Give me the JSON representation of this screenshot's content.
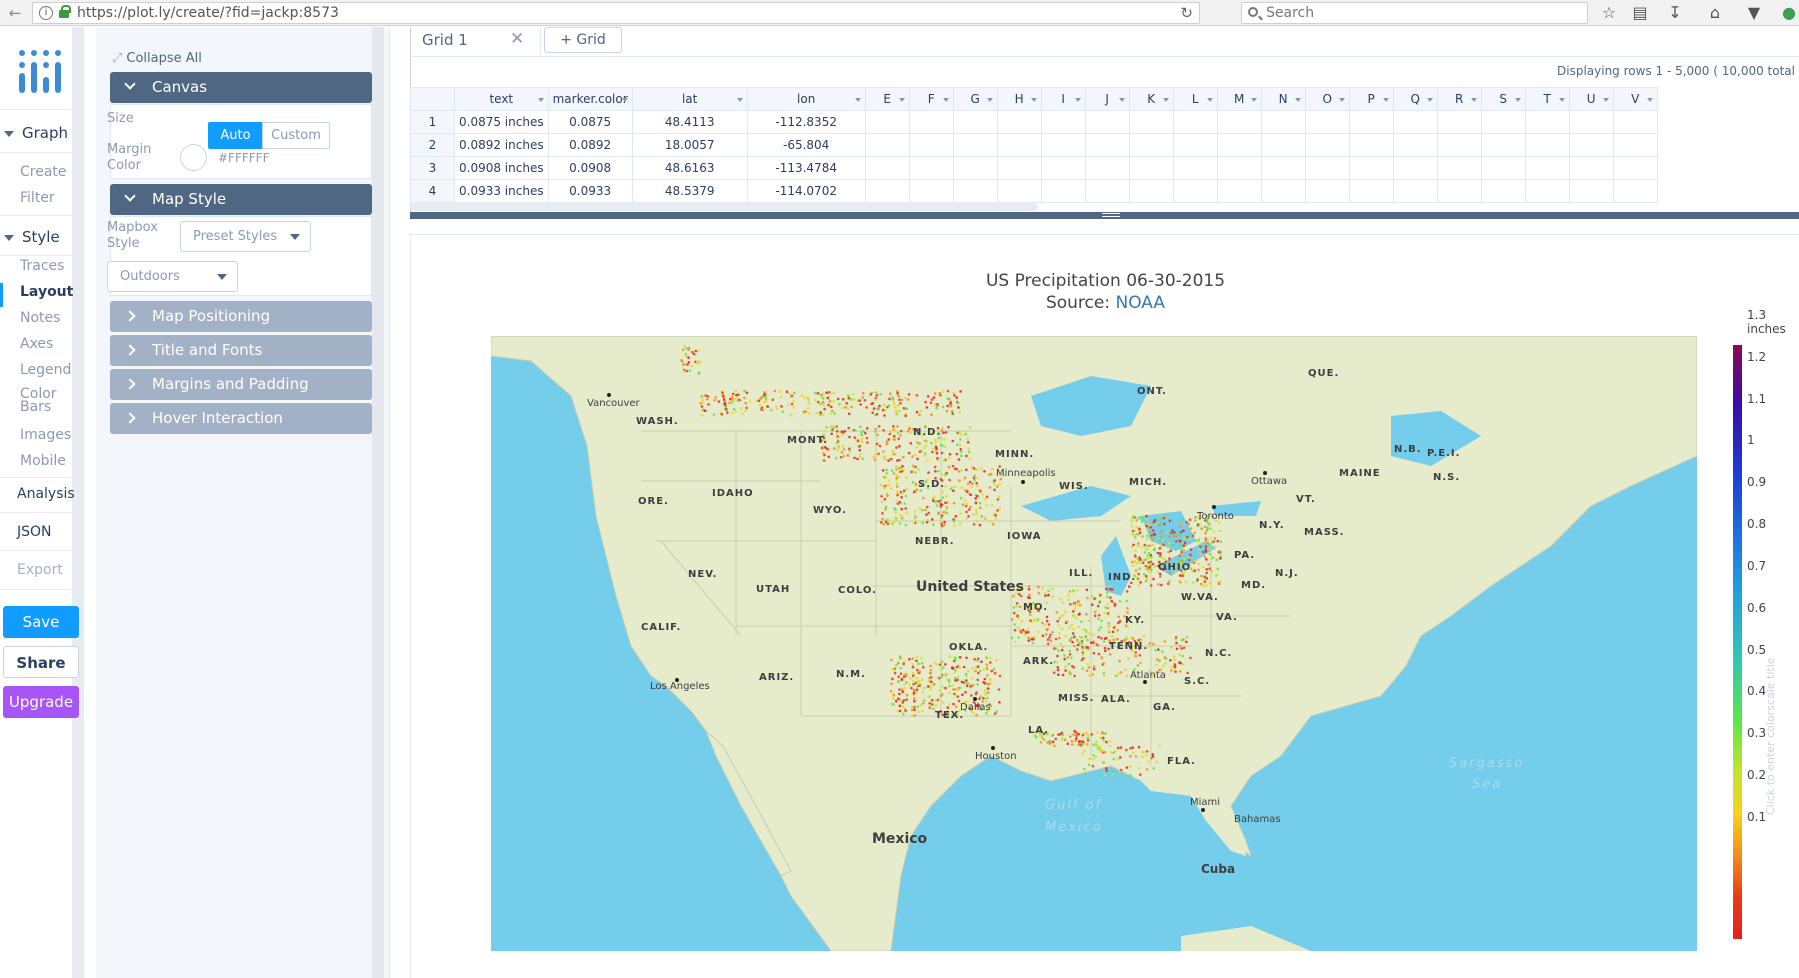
{
  "browser": {
    "url": "https://plot.ly/create/?fid=jackp:8573",
    "search_placeholder": "Search"
  },
  "nav": {
    "sections": [
      {
        "label": "Graph",
        "items": [
          "Create",
          "Filter"
        ]
      },
      {
        "label": "Style",
        "items": [
          "Traces",
          "Layout",
          "Notes",
          "Axes",
          "Legend",
          "Color Bars",
          "Images",
          "Mobile"
        ]
      }
    ],
    "active_item": "Layout",
    "analysis": "Analysis",
    "json": "JSON",
    "export": "Export",
    "save": "Save",
    "share": "Share",
    "upgrade": "Upgrade"
  },
  "panel": {
    "collapse_all": "Collapse All",
    "canvas": {
      "title": "Canvas",
      "size_label": "Size",
      "size_options": [
        "Auto",
        "Custom"
      ],
      "size_selected": "Auto",
      "margin_color_label": "Margin Color",
      "margin_color_value": "#FFFFFF"
    },
    "map_style": {
      "title": "Map Style",
      "mapbox_style_label": "Mapbox Style",
      "preset_placeholder": "Preset Styles",
      "style_value": "Outdoors"
    },
    "collapsed_sections": [
      "Map Positioning",
      "Title and Fonts",
      "Margins and Padding",
      "Hover Interaction"
    ]
  },
  "grid": {
    "tab_label": "Grid 1",
    "add_grid_label": "+ Grid",
    "rows_info": "Displaying rows 1 - 5,000 ( 10,000 total",
    "columns": [
      "text",
      "marker.color",
      "lat",
      "lon",
      "E",
      "F",
      "G",
      "H",
      "I",
      "J",
      "K",
      "L",
      "M",
      "N",
      "O",
      "P",
      "Q",
      "R",
      "S",
      "T",
      "U",
      "V"
    ],
    "rows": [
      {
        "n": "1",
        "text": "0.0875 inches",
        "color": "0.0875",
        "lat": "48.4113",
        "lon": "-112.8352"
      },
      {
        "n": "2",
        "text": "0.0892 inches",
        "color": "0.0892",
        "lat": "18.0057",
        "lon": "-65.804"
      },
      {
        "n": "3",
        "text": "0.0908 inches",
        "color": "0.0908",
        "lat": "48.6163",
        "lon": "-113.4784"
      },
      {
        "n": "4",
        "text": "0.0933 inches",
        "color": "0.0933",
        "lat": "48.5379",
        "lon": "-114.0702"
      }
    ]
  },
  "plot": {
    "title_line1": "US Precipitation 06-30-2015",
    "title_source_prefix": "Source: ",
    "title_source_link": "NOAA",
    "colorbar_ticks": [
      "1.3 inches",
      "1.2",
      "1.1",
      "1",
      "0.9",
      "0.8",
      "0.7",
      "0.6",
      "0.5",
      "0.4",
      "0.3",
      "0.2",
      "0.1"
    ],
    "colorbar_title_placeholder": "Click to enter colorscale title",
    "map_labels": {
      "country_us": "United States",
      "country_mx": "Mexico",
      "cuba": "Cuba",
      "bahamas": "Bahamas",
      "gulf1": "Gulf of",
      "gulf2": "Mexico",
      "sargasso1": "Sargasso",
      "sargasso2": "Sea",
      "states": [
        "WASH.",
        "ORE.",
        "CALIF.",
        "NEV.",
        "IDAHO",
        "MONT.",
        "WYO.",
        "UTAH",
        "ARIZ.",
        "COLO.",
        "N.M.",
        "N.D.",
        "S.D.",
        "NEBR.",
        "OKLA.",
        "TEX.",
        "MINN.",
        "IOWA",
        "MO.",
        "ARK.",
        "LA.",
        "WIS.",
        "ILL.",
        "MICH.",
        "IND.",
        "OHIO",
        "KY.",
        "TENN.",
        "MISS.",
        "ALA.",
        "GA.",
        "FLA.",
        "S.C.",
        "N.C.",
        "VA.",
        "W.VA.",
        "PA.",
        "N.Y.",
        "MD.",
        "N.J.",
        "VT.",
        "MASS.",
        "MAINE",
        "N.B.",
        "N.S.",
        "P.E.I.",
        "QUE.",
        "ONT."
      ],
      "cities": [
        "Vancouver",
        "Minneapolis",
        "Toronto",
        "Ottawa",
        "Los Angeles",
        "Dallas",
        "Houston",
        "Atlanta",
        "Miami"
      ]
    }
  }
}
